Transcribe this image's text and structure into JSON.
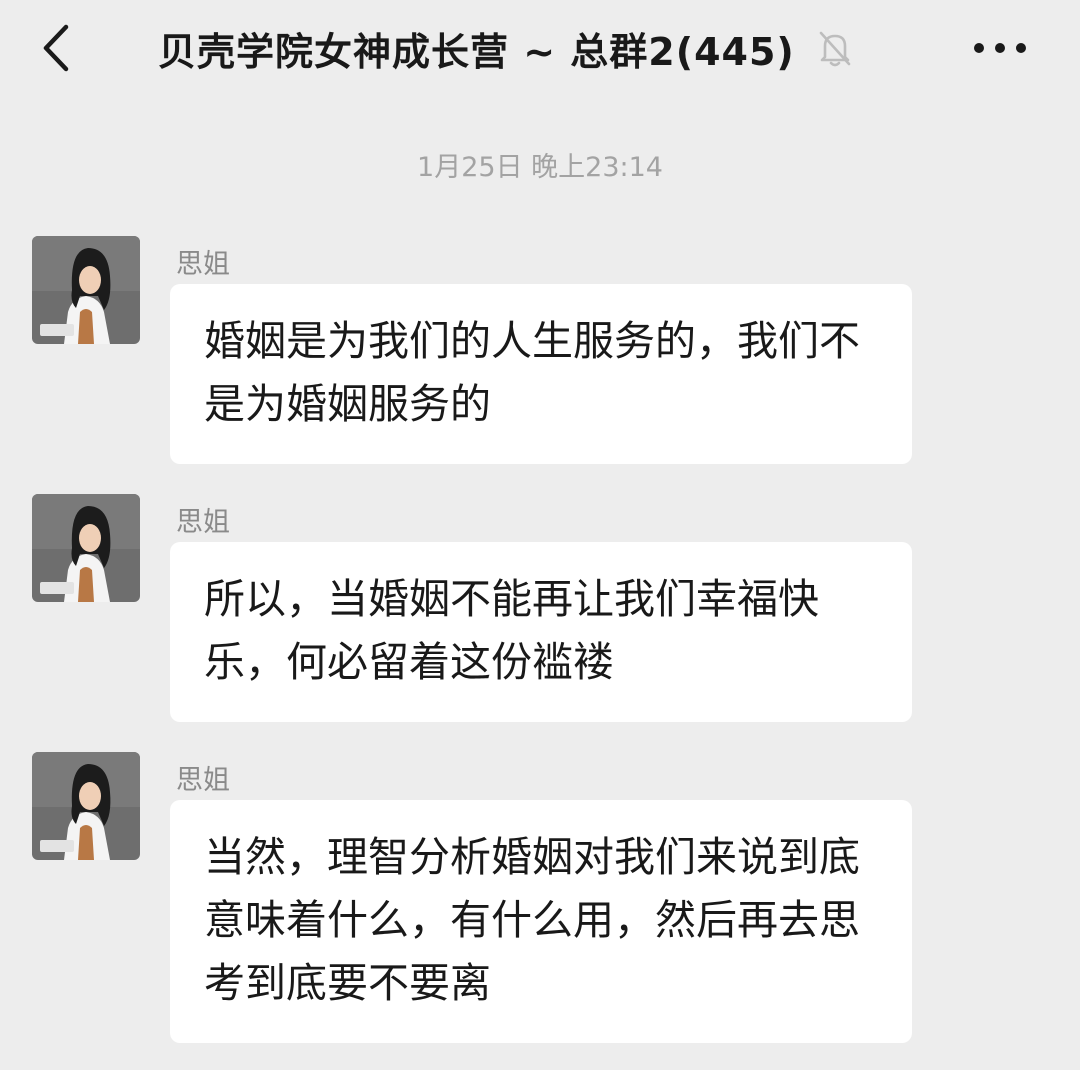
{
  "header": {
    "back_icon": "chevron-left-icon",
    "title": "贝壳学院女神成长营 ~ 总群2(445)",
    "mute_icon": "bell-off-icon",
    "more_icon": "more-dots-icon"
  },
  "chat": {
    "timestamp": "1月25日 晚上23:14",
    "messages": [
      {
        "sender": "思姐",
        "text": "婚姻是为我们的人生服务的，我们不是为婚姻服务的"
      },
      {
        "sender": "思姐",
        "text": "所以，当婚姻不能再让我们幸福快乐，何必留着这份褴褛"
      },
      {
        "sender": "思姐",
        "text": "当然，理智分析婚姻对我们来说到底意味着什么，有什么用，然后再去思考到底要不要离"
      }
    ]
  },
  "colors": {
    "background": "#ededed",
    "bubble": "#ffffff",
    "title": "#191919",
    "meta_text": "#a3a3a3"
  }
}
